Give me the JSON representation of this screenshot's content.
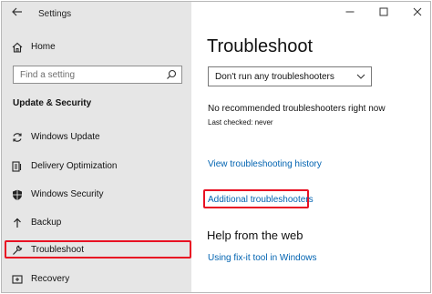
{
  "window": {
    "title": "Settings"
  },
  "sidebar": {
    "home_label": "Home",
    "search_placeholder": "Find a setting",
    "section_title": "Update & Security",
    "items": [
      {
        "label": "Windows Update",
        "icon": "sync-icon"
      },
      {
        "label": "Delivery Optimization",
        "icon": "delivery-optimization-icon"
      },
      {
        "label": "Windows Security",
        "icon": "shield-icon"
      },
      {
        "label": "Backup",
        "icon": "backup-arrow-icon"
      },
      {
        "label": "Troubleshoot",
        "icon": "wrench-icon",
        "selected": true
      },
      {
        "label": "Recovery",
        "icon": "recovery-icon"
      }
    ]
  },
  "main": {
    "title": "Troubleshoot",
    "dropdown_value": "Don't run any troubleshooters",
    "status_text": "No recommended troubleshooters right now",
    "last_checked": "Last checked: never",
    "history_link": "View troubleshooting history",
    "additional_link": "Additional troubleshooters",
    "help_title": "Help from the web",
    "help_link": "Using fix-it tool in Windows"
  },
  "colors": {
    "accent": "#0063b1",
    "highlight": "#e81123",
    "sidebar_bg": "#e6e6e6"
  }
}
